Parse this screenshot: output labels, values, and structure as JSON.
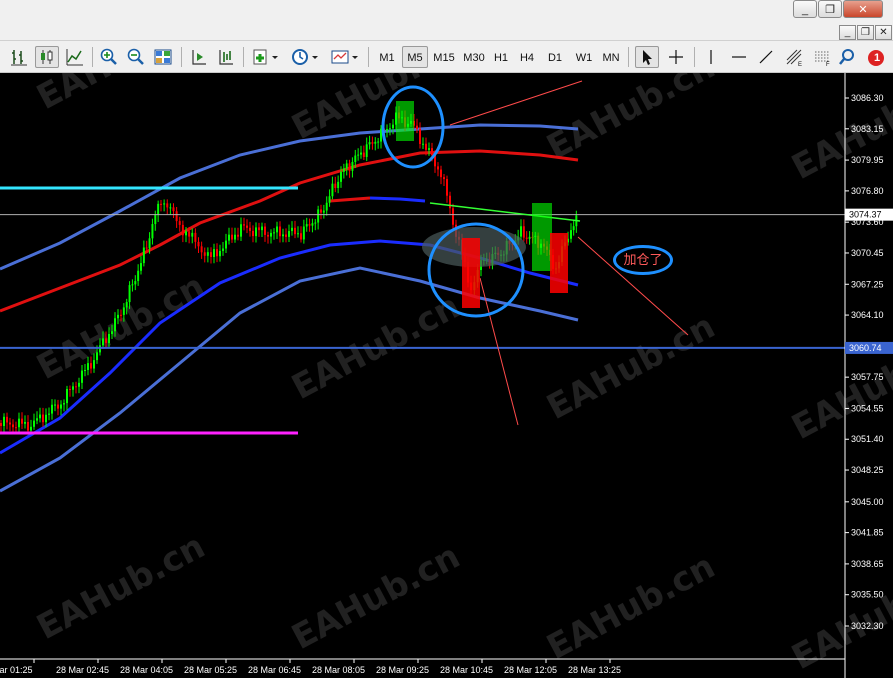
{
  "window": {
    "minimize_glyph": "_",
    "restore_glyph": "❐",
    "close_glyph": "✕",
    "notification_count": "1"
  },
  "toolbar": {
    "timeframes": [
      "M1",
      "M5",
      "M15",
      "M30",
      "H1",
      "H4",
      "D1",
      "W1",
      "MN"
    ],
    "active_timeframe": "M5"
  },
  "chart": {
    "price_labels": [
      "3086.30",
      "3083.15",
      "3079.95",
      "3076.80",
      "3073.60",
      "3070.45",
      "3067.25",
      "3064.10",
      "3060.90",
      "3057.75",
      "3054.55",
      "3051.40",
      "3048.25",
      "3045.00",
      "3041.85",
      "3038.65",
      "3035.50",
      "3032.30"
    ],
    "current_price": "3074.37",
    "level_price": "3060.74",
    "time_labels": [
      "Mar 01:25",
      "28 Mar 02:45",
      "28 Mar 04:05",
      "28 Mar 05:25",
      "28 Mar 06:45",
      "28 Mar 08:05",
      "28 Mar 09:25",
      "28 Mar 10:45",
      "28 Mar 12:05",
      "28 Mar 13:25"
    ],
    "annotation": "加仓了",
    "watermark": "EAHub.cn",
    "colors": {
      "background": "#000000",
      "bullish": "#00ff00",
      "bearish": "#ff0000",
      "outer_band": "#4a6fd6",
      "middle_band": "#e01010",
      "mid_blue": "#1a2cff",
      "cyan_level": "#33e6ff",
      "magenta_level": "#ff22ff",
      "price_line": "#b0b0b0",
      "annotation": "#1e90ff"
    }
  }
}
